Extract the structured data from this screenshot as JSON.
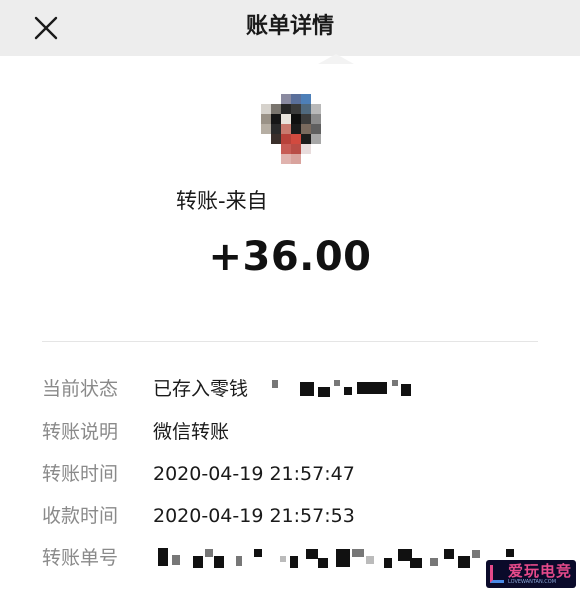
{
  "header": {
    "title": "账单详情",
    "close_icon": "close-icon"
  },
  "transaction": {
    "title_prefix": "转账-来自",
    "amount": "+36.00"
  },
  "details": [
    {
      "label": "当前状态",
      "value": "已存入零钱"
    },
    {
      "label": "转账说明",
      "value": "微信转账"
    },
    {
      "label": "转账时间",
      "value": "2020-04-19 21:57:47"
    },
    {
      "label": "收款时间",
      "value": "2020-04-19 21:57:53"
    },
    {
      "label": "转账单号",
      "value": ""
    }
  ],
  "watermark": {
    "text": "爱玩电竞",
    "sub": "LOVEWANTAN.COM"
  }
}
